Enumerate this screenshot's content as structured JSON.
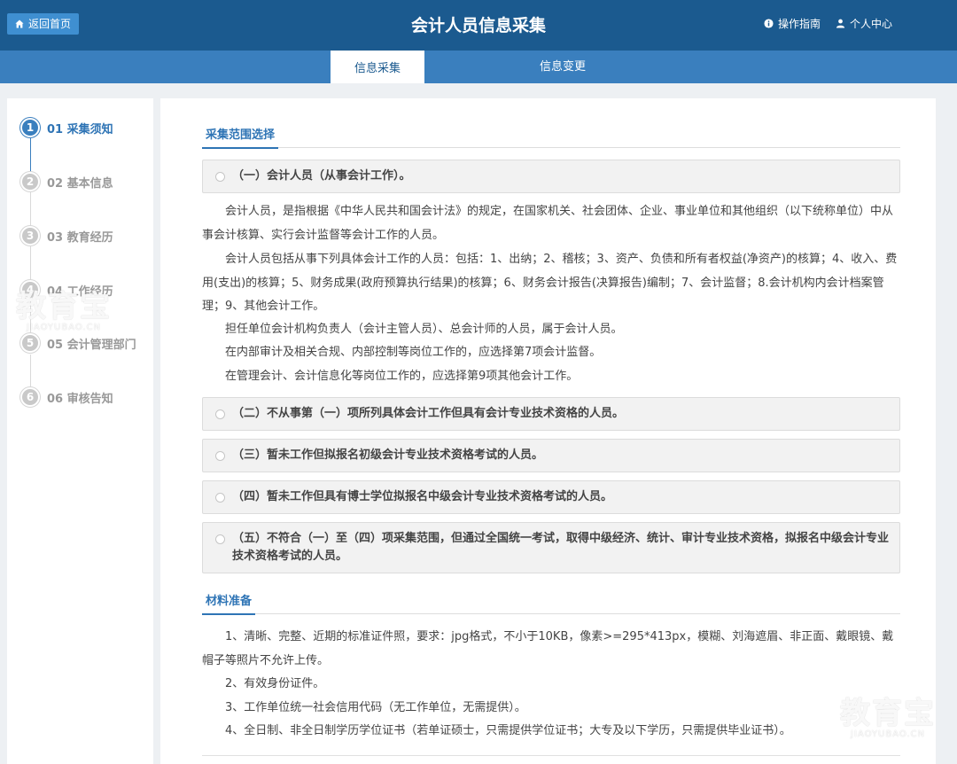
{
  "header": {
    "back_label": "返回首页",
    "title": "会计人员信息采集",
    "guide_label": "操作指南",
    "user_label": "个人中心"
  },
  "tabs": [
    {
      "label": "信息采集",
      "active": true
    },
    {
      "label": "信息变更",
      "active": false
    }
  ],
  "steps": [
    {
      "num": "1",
      "label": "01 采集须知",
      "active": true
    },
    {
      "num": "2",
      "label": "02 基本信息",
      "active": false
    },
    {
      "num": "3",
      "label": "03 教育经历",
      "active": false
    },
    {
      "num": "4",
      "label": "04 工作经历",
      "active": false
    },
    {
      "num": "5",
      "label": "05 会计管理部门",
      "active": false
    },
    {
      "num": "6",
      "label": "06 审核告知",
      "active": false
    }
  ],
  "scope": {
    "heading": "采集范围选择",
    "options": [
      "（一）会计人员（从事会计工作）。",
      "（二）不从事第（一）项所列具体会计工作但具有会计专业技术资格的人员。",
      "（三）暂未工作但拟报名初级会计专业技术资格考试的人员。",
      "（四）暂未工作但具有博士学位拟报名中级会计专业技术资格考试的人员。",
      "（五）不符合（一）至（四）项采集范围，但通过全国统一考试，取得中级经济、统计、审计专业技术资格，拟报名中级会计专业技术资格考试的人员。"
    ],
    "paragraphs": [
      "会计人员，是指根据《中华人民共和国会计法》的规定，在国家机关、社会团体、企业、事业单位和其他组织（以下统称单位）中从事会计核算、实行会计监督等会计工作的人员。",
      "会计人员包括从事下列具体会计工作的人员：包括：1、出纳；2、稽核；3、资产、负债和所有者权益(净资产)的核算；4、收入、费用(支出)的核算；5、财务成果(政府预算执行结果)的核算；6、财务会计报告(决算报告)编制；7、会计监督；8.会计机构内会计档案管理；9、其他会计工作。",
      "担任单位会计机构负责人（会计主管人员）、总会计师的人员，属于会计人员。",
      "在内部审计及相关合规、内部控制等岗位工作的，应选择第7项会计监督。",
      "在管理会计、会计信息化等岗位工作的，应选择第9项其他会计工作。"
    ]
  },
  "materials": {
    "heading": "材料准备",
    "items": [
      "1、清晰、完整、近期的标准证件照，要求：jpg格式，不小于10KB，像素>=295*413px，模糊、刘海遮眉、非正面、戴眼镜、戴帽子等照片不允许上传。",
      "2、有效身份证件。",
      "3、工作单位统一社会信用代码（无工作单位，无需提供）。",
      "4、全日制、非全日制学历学位证书（若单证硕士，只需提供学位证书；大专及以下学历，只需提供毕业证书）。"
    ]
  },
  "watermark": {
    "text": "教育宝",
    "url": "JIAOYUBAO.CN"
  },
  "colors": {
    "header_bg": "#1b5a8f",
    "tabbar_bg": "#3a7fbe",
    "accent": "#2e74b5"
  }
}
